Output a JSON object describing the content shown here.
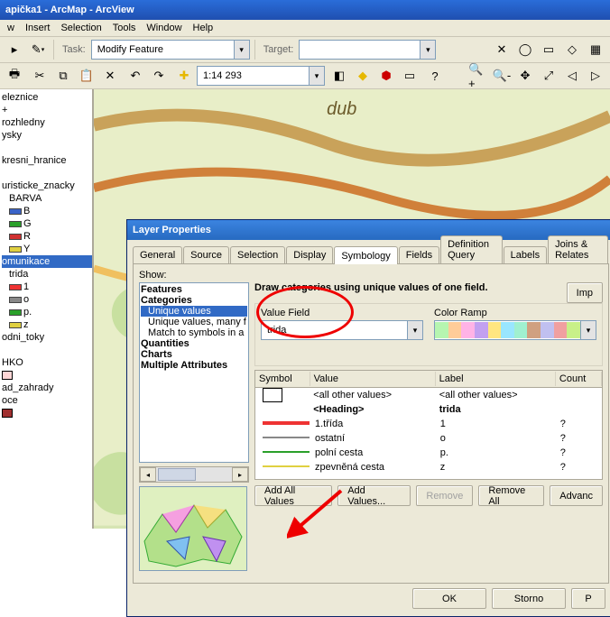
{
  "title": "apička1 - ArcMap - ArcView",
  "menu": {
    "items": [
      "w",
      "Insert",
      "Selection",
      "Tools",
      "Window",
      "Help"
    ]
  },
  "toolbar1": {
    "task_label": "Task:",
    "task_value": "Modify Feature",
    "target_label": "Target:"
  },
  "toolbar2": {
    "scale": "1:14 293"
  },
  "toc": {
    "items": [
      {
        "t": "eleznice"
      },
      {
        "t": "+",
        "s": "#000"
      },
      {
        "t": "rozhledny"
      },
      {
        "t": "ysky"
      },
      {
        "t": ""
      },
      {
        "t": "kresni_hranice"
      },
      {
        "t": ""
      },
      {
        "t": "uristicke_znacky"
      },
      {
        "t": "BARVA",
        "i": 1
      },
      {
        "t": "B",
        "i": 1,
        "c": "#3a63c8"
      },
      {
        "t": "G",
        "i": 1,
        "c": "#2aa02a"
      },
      {
        "t": "R",
        "i": 1,
        "c": "#d03030"
      },
      {
        "t": "Y",
        "i": 1,
        "c": "#e0d040"
      },
      {
        "t": "omunikace",
        "sel": true
      },
      {
        "t": "trida",
        "i": 1
      },
      {
        "t": "1",
        "i": 1,
        "c": "#e33"
      },
      {
        "t": "o",
        "i": 1,
        "c": "#888"
      },
      {
        "t": "p.",
        "i": 1,
        "c": "#2aa02a"
      },
      {
        "t": "z",
        "i": 1,
        "c": "#e0d040"
      },
      {
        "t": "odni_toky"
      },
      {
        "t": ""
      },
      {
        "t": "HKO"
      },
      {
        "t": "",
        "box": "#ffd6d6"
      },
      {
        "t": "ad_zahrady"
      },
      {
        "t": "oce"
      },
      {
        "t": "",
        "box": "#a03030"
      }
    ]
  },
  "dialog": {
    "title": "Layer Properties",
    "tabs": [
      "General",
      "Source",
      "Selection",
      "Display",
      "Symbology",
      "Fields",
      "Definition Query",
      "Labels",
      "Joins & Relates"
    ],
    "active_tab": "Symbology",
    "show_label": "Show:",
    "show_list": [
      {
        "t": "Features",
        "b": true
      },
      {
        "t": "Categories",
        "b": true
      },
      {
        "t": "Unique values",
        "i": 1,
        "hl": true
      },
      {
        "t": "Unique values, many f",
        "i": 1
      },
      {
        "t": "Match to symbols in a",
        "i": 1
      },
      {
        "t": "Quantities",
        "b": true
      },
      {
        "t": "Charts",
        "b": true
      },
      {
        "t": "Multiple Attributes",
        "b": true
      }
    ],
    "desc": "Draw categories using unique values of one field.",
    "import_btn": "Imp",
    "value_field_label": "Value Field",
    "value_field_value": "trida",
    "color_ramp_label": "Color Ramp",
    "color_ramp": [
      "#b6f5b0",
      "#ffcc99",
      "#ffb3e6",
      "#c2a0f0",
      "#ffe680",
      "#99e6ff",
      "#a0f0d0",
      "#d0a080",
      "#c0c0f0",
      "#f0a0a0",
      "#c8f088"
    ],
    "grid_headers": {
      "symbol": "Symbol",
      "value": "Value",
      "label": "Label",
      "count": "Count"
    },
    "grid_rows": [
      {
        "sym": "check",
        "val": "<all other values>",
        "lbl": "<all other values>",
        "cnt": ""
      },
      {
        "sym": "",
        "val": "<Heading>",
        "lbl": "trida",
        "cnt": "",
        "bold": true
      },
      {
        "sym": "#e33",
        "thick": true,
        "val": "1.třída",
        "lbl": "1",
        "cnt": "?"
      },
      {
        "sym": "#888",
        "val": "ostatní",
        "lbl": "o",
        "cnt": "?"
      },
      {
        "sym": "#2aa02a",
        "val": "polní cesta",
        "lbl": "p.",
        "cnt": "?"
      },
      {
        "sym": "#e0d040",
        "val": "zpevněná cesta",
        "lbl": "z",
        "cnt": "?"
      }
    ],
    "buttons": {
      "add_all": "Add All Values",
      "add": "Add Values...",
      "remove": "Remove",
      "remove_all": "Remove All",
      "advanced": "Advanc"
    },
    "ok": "OK",
    "cancel": "Storno",
    "apply": "P"
  }
}
